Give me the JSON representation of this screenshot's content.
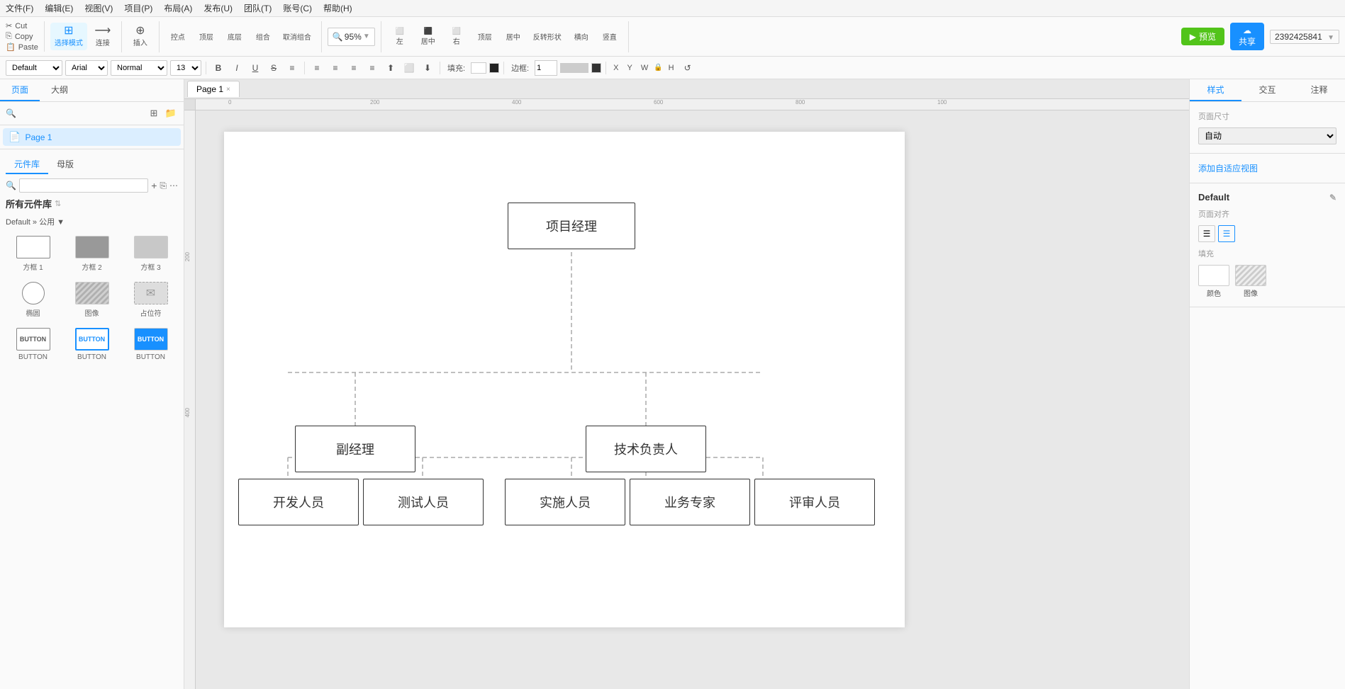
{
  "menu": {
    "items": [
      "文件(F)",
      "编辑(E)",
      "视图(V)",
      "项目(P)",
      "布局(A)",
      "发布(U)",
      "团队(T)",
      "账号(C)",
      "帮助(H)"
    ]
  },
  "toolbar": {
    "cut_label": "Cut",
    "copy_label": "Copy",
    "paste_label": "Paste",
    "select_mode_label": "选择模式",
    "connect_label": "连接",
    "insert_label": "插入",
    "control_label": "控点",
    "top_label": "顶层",
    "bottom_label": "底层",
    "combine_label": "组合",
    "uncombine_label": "取消组合",
    "left_label": "左",
    "center_label": "居中",
    "right_label": "右",
    "top2_label": "顶层",
    "mid_label": "居中",
    "transform_label": "反转形状",
    "horizontal_label": "横向",
    "vertical_label": "竖直",
    "zoom_value": "95%",
    "preview_label": "预览",
    "share_label": "共享",
    "id_value": "2392425841"
  },
  "format_bar": {
    "style_default": "Default",
    "font_default": "Arial",
    "weight_default": "Normal",
    "size_default": "13",
    "fill_label": "填充:",
    "border_label": "边框:",
    "x_label": "X",
    "y_label": "Y",
    "w_label": "W",
    "h_label": "H"
  },
  "left_panel": {
    "tab_pages": "页面",
    "tab_outline": "大纲",
    "page1_label": "Page 1",
    "comp_tab_library": "元件库",
    "comp_tab_master": "母版",
    "all_libraries": "所有元件库",
    "default_public": "Default » 公用 ▼",
    "comp_items": [
      {
        "label": "方框 1",
        "type": "outline"
      },
      {
        "label": "方框 2",
        "type": "filled"
      },
      {
        "label": "方框 3",
        "type": "gray"
      },
      {
        "label": "椭圆",
        "type": "circle"
      },
      {
        "label": "图像",
        "type": "image"
      },
      {
        "label": "占位符",
        "type": "placeholder"
      },
      {
        "label": "BUTTON",
        "type": "btn-outline"
      },
      {
        "label": "BUTTON",
        "type": "btn-blue"
      },
      {
        "label": "BUTTON",
        "type": "btn-dark"
      }
    ]
  },
  "canvas": {
    "tab_label": "Page 1",
    "ruler_marks_h": [
      "0",
      "200",
      "400",
      "600",
      "800",
      "100"
    ],
    "ruler_marks_v": [
      "200",
      "400"
    ]
  },
  "diagram": {
    "project_manager": "项目经理",
    "vice_manager": "副经理",
    "tech_lead": "技术负责人",
    "developer": "开发人员",
    "tester": "测试人员",
    "implementer": "实施人员",
    "business_expert": "业务专家",
    "reviewer": "评审人员"
  },
  "right_panel": {
    "tab_style": "样式",
    "tab_interact": "交互",
    "tab_note": "注释",
    "page_size_label": "页面尺寸",
    "page_size_value": "自动",
    "adaptive_view_label": "添加自适应视图",
    "default_label": "Default",
    "page_align_label": "页面对齐",
    "fill_label": "填充",
    "fill_color_label": "颜色",
    "fill_image_label": "图像"
  }
}
